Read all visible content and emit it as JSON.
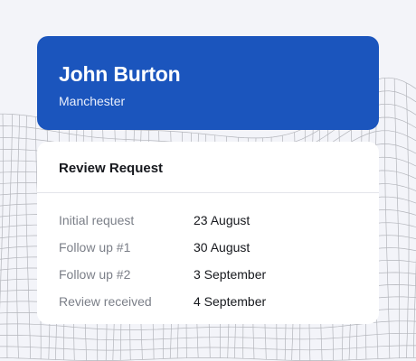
{
  "profile": {
    "name": "John Burton",
    "location": "Manchester"
  },
  "review": {
    "title": "Review Request",
    "rows": [
      {
        "label": "Initial request",
        "value": "23 August"
      },
      {
        "label": "Follow up #1",
        "value": "30 August"
      },
      {
        "label": "Follow up #2",
        "value": "3 September"
      },
      {
        "label": "Review received",
        "value": "4 September"
      }
    ]
  },
  "colors": {
    "header_background": "#1b55bd",
    "page_background": "#f3f4f9",
    "mesh_lines": "#a9abb1"
  }
}
